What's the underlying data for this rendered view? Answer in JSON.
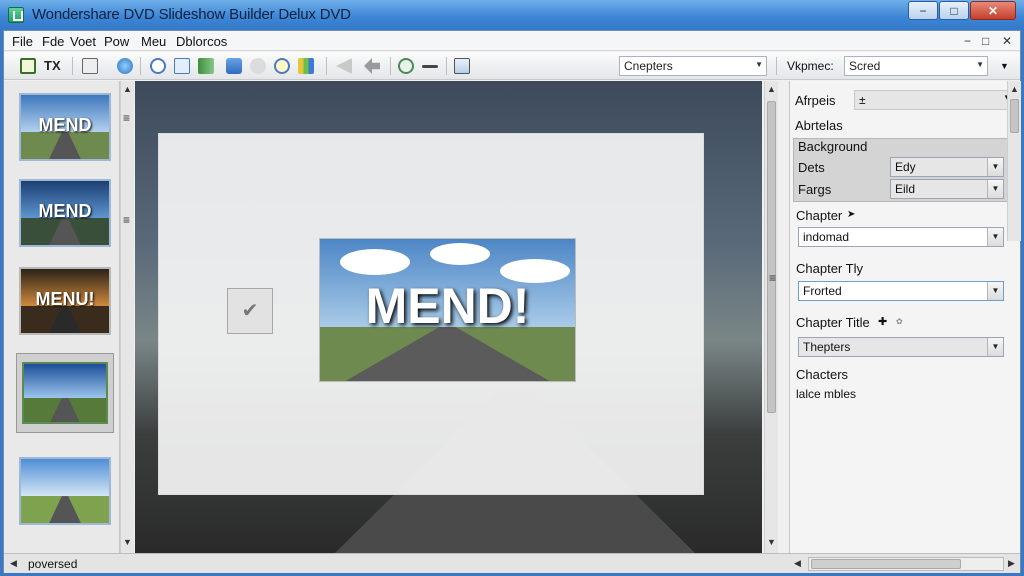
{
  "window": {
    "title": "Wondershare DVD Slideshow Builder Delux DVD",
    "minimize": "−",
    "restore": "□",
    "close": "✕"
  },
  "menu": {
    "items": [
      "File",
      "Fde",
      "Voet",
      "Pow",
      "Meu",
      "Dblorcos"
    ],
    "mdi_min": "−",
    "mdi_restore": "□",
    "mdi_close": "✕"
  },
  "toolbar": {
    "tx_label": "TX",
    "chapters_combo": "Cnepters",
    "view_label": "Vkpmec:",
    "view_combo": "Scred"
  },
  "thumbnails": [
    {
      "label": "MEND"
    },
    {
      "label": "MEND"
    },
    {
      "label": "MENU!"
    },
    {
      "label": ""
    },
    {
      "label": ""
    }
  ],
  "preview": {
    "menu_text": "MEND!",
    "checkbox_glyph": "✔"
  },
  "properties": {
    "top_combo_label": "Afrpeis",
    "top_combo_value": "±",
    "section_header": "Abrtelas",
    "background_label": "Background",
    "dets_label": "Dets",
    "dets_value": "Edy",
    "fargs_label": "Fargs",
    "fargs_value": "Eild",
    "chapter_label": "Chapter",
    "chapter_value": "indomad",
    "chapter_tily_label": "Chapter Tly",
    "chapter_tily_value": "Frorted",
    "chapter_title_label": "Chapter Title",
    "chapter_title_value": "Thepters",
    "characters_label": "Chacters",
    "characters_value": "lalce mbles"
  },
  "status": {
    "text": "poversed"
  },
  "colors": {
    "titlebar": "#3f86d6",
    "accent": "#6a9fd6"
  }
}
